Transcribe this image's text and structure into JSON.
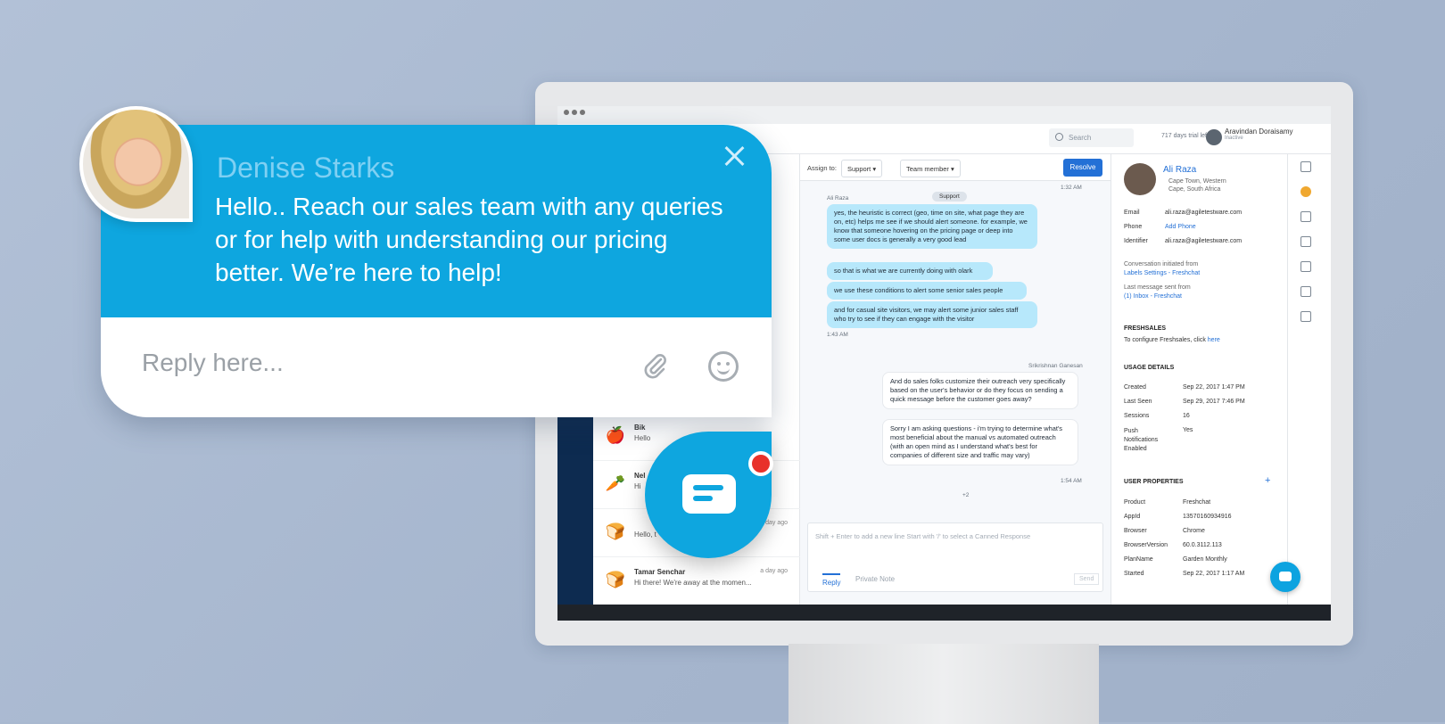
{
  "widget": {
    "agent_name": "Denise Starks",
    "message": "Hello.. Reach our sales team with any queries or for help with understanding our pricing better. We’re here to help!",
    "reply_placeholder": "Reply here...",
    "icons": [
      "close-icon",
      "paperclip-icon",
      "smiley-icon",
      "chat-bubble-icon"
    ]
  },
  "app": {
    "search_placeholder": "Search",
    "trial": "717 days trial left",
    "user_name": "Aravindan Doraisamy",
    "user_status": "Inactive"
  },
  "conversations": [
    {
      "avatar": "🍎",
      "name": "Bik",
      "tag": "VISITOR",
      "preview": "Hello",
      "time": ""
    },
    {
      "avatar": "🥕",
      "name": "Nel",
      "tag": "",
      "preview": "Hi",
      "time": ""
    },
    {
      "avatar": "🍞",
      "name": "",
      "tag": "VISITOR",
      "preview": "Hello, t",
      "time": "a day ago"
    },
    {
      "avatar": "🍞",
      "name": "Tamar Senchar",
      "tag": "",
      "preview": "Hi there! We're away at the momen...",
      "time": "a day ago"
    }
  ],
  "toolbar": {
    "assign_to": "Assign to:",
    "group": "Support",
    "member": "Team member",
    "resolve": "Resolve"
  },
  "thread": {
    "first_stamp": "1:32 AM",
    "group_pill": "Support",
    "agent_label": "Ali Raza",
    "messages_in": [
      "yes, the heuristic is correct (geo, time on site, what page they are on, etc) helps me see if we should alert someone. for example, we know that someone hovering on the pricing page or deep into some user docs is generally a very good lead",
      "so that is what we are currently doing with olark",
      "we use these conditions to alert some senior sales people",
      "and for casual site visitors, we may alert some junior sales staff who try to see if they can engage with the visitor"
    ],
    "stamp_in": "1:43 AM",
    "responder_label": "Srikrishnan Ganesan",
    "messages_out": [
      "And do sales folks customize their outreach very specifically based on the user's behavior or do they focus on sending a quick message before the customer goes away?",
      "Sorry I am asking questions - i'm trying to determine what's most beneficial about the manual vs automated outreach (with an open mind as I understand what's best for companies of different size and traffic may vary)"
    ],
    "stamp_out": "1:54 AM",
    "participants_more": "+2"
  },
  "composer": {
    "placeholder": "Shift + Enter to add a new line Start with '/' to select a Canned Response",
    "tab_reply": "Reply",
    "tab_note": "Private Note",
    "send": "Send"
  },
  "contact": {
    "name": "Ali Raza",
    "location": "Cape Town, Western Cape, South Africa",
    "email_label": "Email",
    "email": "ali.raza@agiletestware.com",
    "phone_label": "Phone",
    "phone": "Add Phone",
    "identifier_label": "Identifier",
    "identifier": "ali.raza@agiletestware.com",
    "initiated_label": "Conversation initiated from",
    "initiated": "Labels Settings - Freshchat",
    "last_label": "Last message sent from",
    "last": "(1) Inbox - Freshchat",
    "freshsales_head": "FRESHSALES",
    "freshsales_text": "To configure Freshsales, click",
    "freshsales_link": "here",
    "usage_head": "USAGE DETAILS",
    "usage": [
      {
        "k": "Created",
        "v": "Sep 22, 2017 1:47 PM"
      },
      {
        "k": "Last Seen",
        "v": "Sep 29, 2017 7:46 PM"
      },
      {
        "k": "Sessions",
        "v": "16"
      },
      {
        "k": "Push Notifications Enabled",
        "v": "Yes"
      }
    ],
    "props_head": "USER PROPERTIES",
    "props": [
      {
        "k": "Product",
        "v": "Freshchat"
      },
      {
        "k": "AppId",
        "v": "1357016093491​6"
      },
      {
        "k": "Browser",
        "v": "Chrome"
      },
      {
        "k": "BrowserVersion",
        "v": "60.0.3112.113"
      },
      {
        "k": "PlanName",
        "v": "Garden Monthly"
      },
      {
        "k": "Started",
        "v": "Sep 22, 2017 1:17 AM"
      }
    ]
  },
  "colors": {
    "brand": "#0ea6df",
    "resolve": "#2370d6",
    "notification": "#e8312a",
    "background": "#a9b9d0"
  }
}
